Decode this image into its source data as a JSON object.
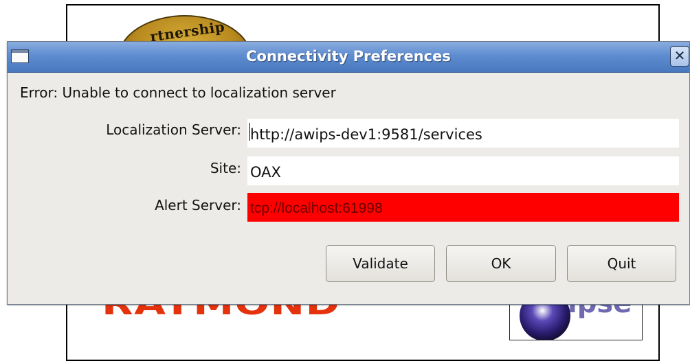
{
  "background_window": {
    "seal_text": "rtnership"
  },
  "dialog": {
    "title": "Connectivity Preferences",
    "close_label": "✕",
    "error_message": "Error: Unable to connect to localization server",
    "fields": [
      {
        "label": "Localization Server:",
        "value": "http://awips-dev1:9581/services",
        "status": "normal"
      },
      {
        "label": "Site:",
        "value": "OAX",
        "status": "normal"
      },
      {
        "label": "Alert Server:",
        "value": "tcp://localhost:61998",
        "status": "error"
      }
    ],
    "buttons": {
      "validate": "Validate",
      "ok": "OK",
      "quit": "Quit"
    }
  },
  "colors": {
    "title_bar": "#5e8cd0",
    "dialog_bg": "#edebe7",
    "error_field": "#ff0000",
    "error_text": "#6a0000"
  },
  "icons": {
    "window_menu": "window-menu-icon",
    "close": "close-icon"
  }
}
